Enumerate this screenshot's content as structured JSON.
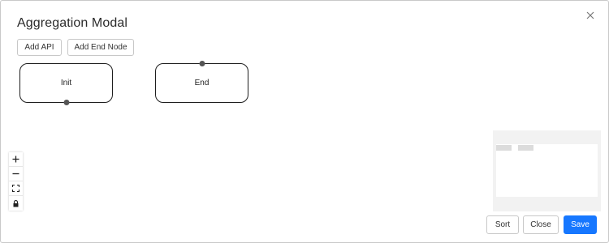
{
  "modal": {
    "title": "Aggregation Modal"
  },
  "toolbar": {
    "add_api_label": "Add API",
    "add_end_node_label": "Add End Node"
  },
  "canvas": {
    "nodes": [
      {
        "label": "Init"
      },
      {
        "label": "End"
      }
    ],
    "controls": [
      {
        "icon": "zoom-in-icon",
        "glyph": "+"
      },
      {
        "icon": "zoom-out-icon",
        "glyph": "—"
      },
      {
        "icon": "fit-view-icon"
      },
      {
        "icon": "lock-icon"
      }
    ]
  },
  "footer": {
    "sort_label": "Sort",
    "close_label": "Close",
    "save_label": "Save"
  },
  "colors": {
    "primary": "#1677ff",
    "node_border": "#1e1e1e",
    "handle": "#555555",
    "minimap_bg": "#f2f2f2"
  }
}
